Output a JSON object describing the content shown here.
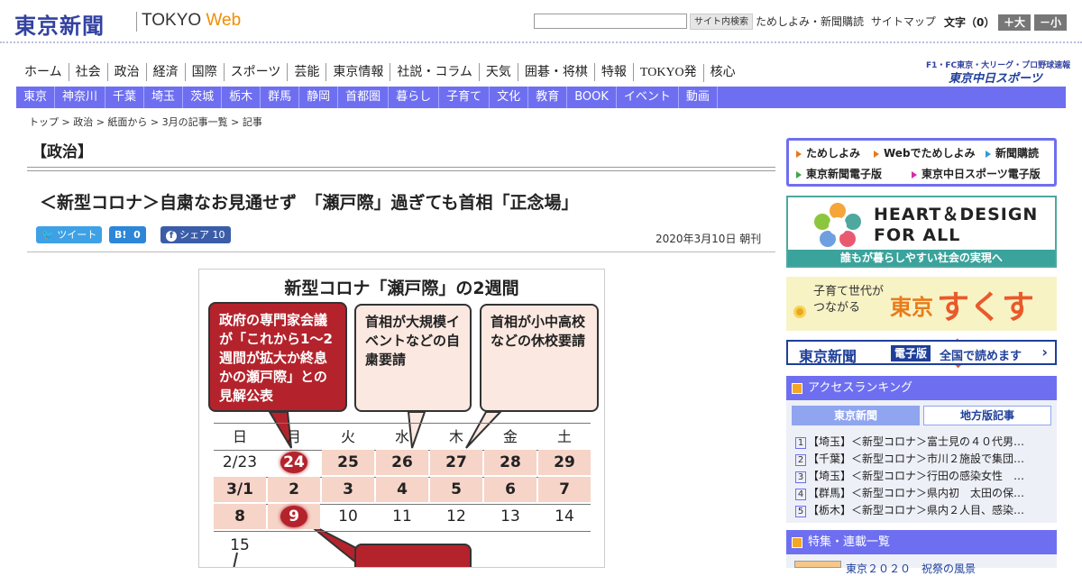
{
  "header": {
    "logo_jp": "東京新聞",
    "logo_en_a": "TOKYO ",
    "logo_en_b": "Web",
    "search_placeholder": "",
    "search_button": "サイト内検索",
    "util_links": [
      "ためしよみ・新聞購読",
      "サイトマップ"
    ],
    "font_size_label": "文字（0）",
    "font_plus": "＋大",
    "font_minus": "－小"
  },
  "nav_primary": [
    "ホーム",
    "社会",
    "政治",
    "経済",
    "国際",
    "スポーツ",
    "芸能",
    "東京情報",
    "社説・コラム",
    "天気",
    "囲碁・将棋",
    "特報",
    "TOKYO発",
    "核心"
  ],
  "chunichi": {
    "tagline": "F1・FC東京・大リーグ・プロ野球速報",
    "logo": "東京中日スポーツ"
  },
  "nav_secondary": [
    "東京",
    "神奈川",
    "千葉",
    "埼玉",
    "茨城",
    "栃木",
    "群馬",
    "静岡",
    "首都圏",
    "暮らし",
    "子育て",
    "文化",
    "教育",
    "BOOK",
    "イベント",
    "動画"
  ],
  "breadcrumb": "トップ > 政治 > 紙面から > 3月の記事一覧 > 記事",
  "section_label": "【政治】",
  "article": {
    "title": "＜新型コロナ＞自粛なお見通せず　「瀬戸際」過ぎても首相「正念場」",
    "date": "2020年3月10日 朝刊"
  },
  "share": {
    "tweet": "ツイート",
    "hatena": "B!",
    "hatena_count": "0",
    "fb": "シェア 10"
  },
  "figure": {
    "title": "新型コロナ「瀬戸際」の2週間",
    "balloon1": "政府の専門家会議が「これから1～2週間が拡大か終息かの瀬戸際」との見解公表",
    "balloon2": "首相が大規模イベントなどの自粛要請",
    "balloon3": "首相が小中高校などの休校要請",
    "weekdays": [
      "日",
      "月",
      "火",
      "水",
      "木",
      "金",
      "土"
    ],
    "row1": [
      "2/23",
      "24",
      "25",
      "26",
      "27",
      "28",
      "29"
    ],
    "row2": [
      "3/1",
      "2",
      "3",
      "4",
      "5",
      "6",
      "7"
    ],
    "row3": [
      "8",
      "9",
      "10",
      "11",
      "12",
      "13",
      "14"
    ],
    "row4": [
      "15"
    ]
  },
  "sidebar": {
    "links": [
      "ためしよみ",
      "Webでためしよみ",
      "新聞購読",
      "東京新聞電子版",
      "東京中日スポーツ電子版"
    ],
    "link_colors": [
      "#e8781a",
      "#e8781a",
      "#2a9ad6",
      "#3aa745",
      "#d62aa8"
    ],
    "banner1_line1": "HEART＆DESIGN",
    "banner1_line2": "FOR ALL",
    "banner1_sub": "誰もが暮らしやすい社会の実現へ",
    "banner2_small": "子育て世代が　　　　　　つながる",
    "banner2_city": "東京",
    "banner2_main": "すくすく",
    "banner3_a": "東京新聞",
    "banner3_b": "電子版",
    "banner3_c": "全国で読めます",
    "ranking_title": "アクセスランキング",
    "tab_a": "東京新聞",
    "tab_b": "地方版記事",
    "ranking": [
      {
        "n": "1",
        "text": "【埼玉】＜新型コロナ＞富士見の４０代男…"
      },
      {
        "n": "2",
        "text": "【千葉】＜新型コロナ＞市川２施設で集団…"
      },
      {
        "n": "3",
        "text": "【埼玉】＜新型コロナ＞行田の感染女性　…"
      },
      {
        "n": "4",
        "text": "【群馬】＜新型コロナ＞県内初　太田の保…"
      },
      {
        "n": "5",
        "text": "【栃木】＜新型コロナ＞県内２人目、感染…"
      }
    ],
    "feature_title": "特集・連載一覧",
    "feature_item": "東京２０２０　祝祭の風景"
  }
}
